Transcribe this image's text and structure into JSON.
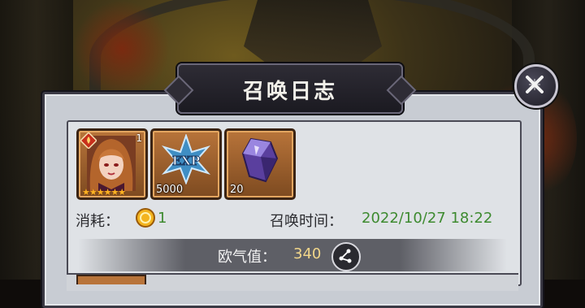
{
  "dialog": {
    "title": "召唤日志",
    "items": [
      {
        "name": "hero-card",
        "corner": "1",
        "stars": "★★★★★★",
        "count": ""
      },
      {
        "name": "exp-crystal",
        "label": "EXP",
        "count": "5000"
      },
      {
        "name": "purple-crystal",
        "count": "20"
      }
    ],
    "cost_label": "消耗：",
    "cost_value": "1",
    "time_label": "召唤时间：",
    "time_value": "2022/10/27 18:22",
    "luck_label": "欧气值：",
    "luck_value": "340"
  },
  "colors": {
    "accent_green": "#3d8a2f",
    "luck_gold": "#f1d68a",
    "item_frame": "#b8743a"
  },
  "icons": [
    "close-icon",
    "fire-element-icon",
    "exp-star-icon",
    "crystal-icon",
    "coin-icon",
    "share-icon"
  ]
}
